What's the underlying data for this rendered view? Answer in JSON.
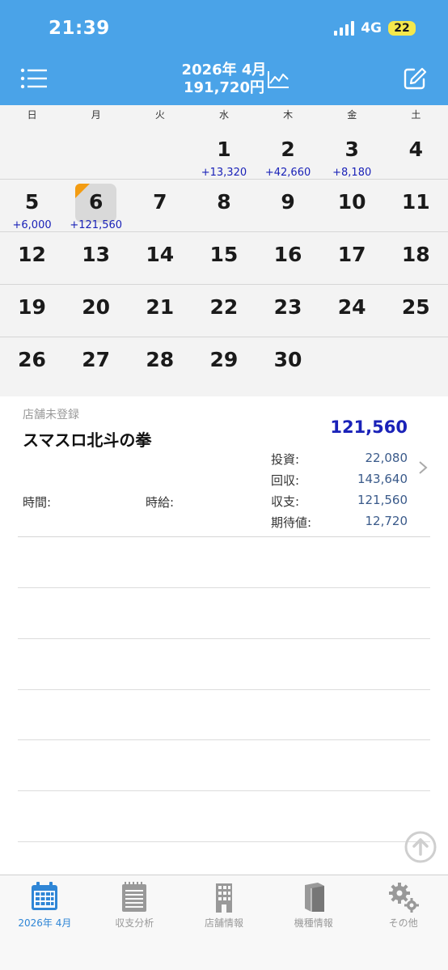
{
  "status_bar": {
    "time": "21:39",
    "network": "4G",
    "battery": "22"
  },
  "header": {
    "month": "2026年 4月",
    "total": "191,720円"
  },
  "weekdays": [
    "日",
    "月",
    "火",
    "水",
    "木",
    "金",
    "土"
  ],
  "calendar": {
    "weeks": [
      [
        {
          "day": "",
          "amount": ""
        },
        {
          "day": "",
          "amount": ""
        },
        {
          "day": "",
          "amount": ""
        },
        {
          "day": "1",
          "amount": "+13,320"
        },
        {
          "day": "2",
          "amount": "+42,660"
        },
        {
          "day": "3",
          "amount": "+8,180"
        },
        {
          "day": "4",
          "amount": ""
        }
      ],
      [
        {
          "day": "5",
          "amount": "+6,000"
        },
        {
          "day": "6",
          "amount": "+121,560"
        },
        {
          "day": "7",
          "amount": ""
        },
        {
          "day": "8",
          "amount": ""
        },
        {
          "day": "9",
          "amount": ""
        },
        {
          "day": "10",
          "amount": ""
        },
        {
          "day": "11",
          "amount": ""
        }
      ],
      [
        {
          "day": "12",
          "amount": ""
        },
        {
          "day": "13",
          "amount": ""
        },
        {
          "day": "14",
          "amount": ""
        },
        {
          "day": "15",
          "amount": ""
        },
        {
          "day": "16",
          "amount": ""
        },
        {
          "day": "17",
          "amount": ""
        },
        {
          "day": "18",
          "amount": ""
        }
      ],
      [
        {
          "day": "19",
          "amount": ""
        },
        {
          "day": "20",
          "amount": ""
        },
        {
          "day": "21",
          "amount": ""
        },
        {
          "day": "22",
          "amount": ""
        },
        {
          "day": "23",
          "amount": ""
        },
        {
          "day": "24",
          "amount": ""
        },
        {
          "day": "25",
          "amount": ""
        }
      ],
      [
        {
          "day": "26",
          "amount": ""
        },
        {
          "day": "27",
          "amount": ""
        },
        {
          "day": "28",
          "amount": ""
        },
        {
          "day": "29",
          "amount": ""
        },
        {
          "day": "30",
          "amount": ""
        },
        {
          "day": "",
          "amount": ""
        },
        {
          "day": "",
          "amount": ""
        }
      ]
    ],
    "selected_day": "6"
  },
  "entry": {
    "store": "店舗未登録",
    "machine": "スマスロ北斗の拳",
    "net": "121,560",
    "stats": [
      {
        "label": "投資:",
        "value": "22,080"
      },
      {
        "label": "回収:",
        "value": "143,640"
      },
      {
        "label": "収支:",
        "value": "121,560"
      },
      {
        "label": "期待値:",
        "value": "12,720"
      }
    ],
    "time_label": "時間:",
    "wage_label": "時給:"
  },
  "tabs": [
    {
      "label": "2026年 4月",
      "icon": "calendar-icon",
      "active": true
    },
    {
      "label": "収支分析",
      "icon": "notepad-icon",
      "active": false
    },
    {
      "label": "店舗情報",
      "icon": "building-icon",
      "active": false
    },
    {
      "label": "機種情報",
      "icon": "book-icon",
      "active": false
    },
    {
      "label": "その他",
      "icon": "gear-icon",
      "active": false
    }
  ],
  "colors": {
    "header_bg": "#4aa3e8",
    "amount_blue": "#1a22b8",
    "selected_marker": "#f39c12",
    "active_tab": "#2f86d6"
  }
}
